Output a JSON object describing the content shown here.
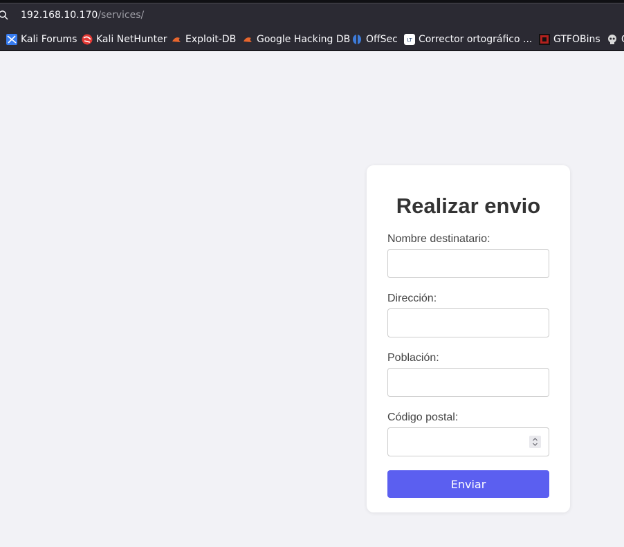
{
  "browser": {
    "url_host": "192.168.10.170",
    "url_path": "/services/",
    "bookmarks": [
      {
        "label": "Kali Forums",
        "icon": "kali-forums-icon"
      },
      {
        "label": "Kali NetHunter",
        "icon": "kali-nethunter-icon"
      },
      {
        "label": "Exploit-DB",
        "icon": "exploit-db-icon"
      },
      {
        "label": "Google Hacking DB",
        "icon": "ghdb-icon"
      },
      {
        "label": "OffSec",
        "icon": "offsec-icon"
      },
      {
        "label": "Corrector ortográfico ...",
        "icon": "languagetool-icon"
      },
      {
        "label": "GTFOBins",
        "icon": "gtfobins-icon"
      },
      {
        "label": "G",
        "icon": "skull-icon"
      }
    ]
  },
  "form": {
    "title": "Realizar envio",
    "fields": [
      {
        "label": "Nombre destinatario:",
        "value": "",
        "type": "text"
      },
      {
        "label": "Dirección:",
        "value": "",
        "type": "text"
      },
      {
        "label": "Población:",
        "value": "",
        "type": "text"
      },
      {
        "label": "Código postal:",
        "value": "",
        "type": "number"
      }
    ],
    "submit_label": "Enviar"
  },
  "colors": {
    "page_bg": "#f2f2f6",
    "button_bg": "#5b5ff0",
    "chrome_bg": "#2b2a33"
  }
}
